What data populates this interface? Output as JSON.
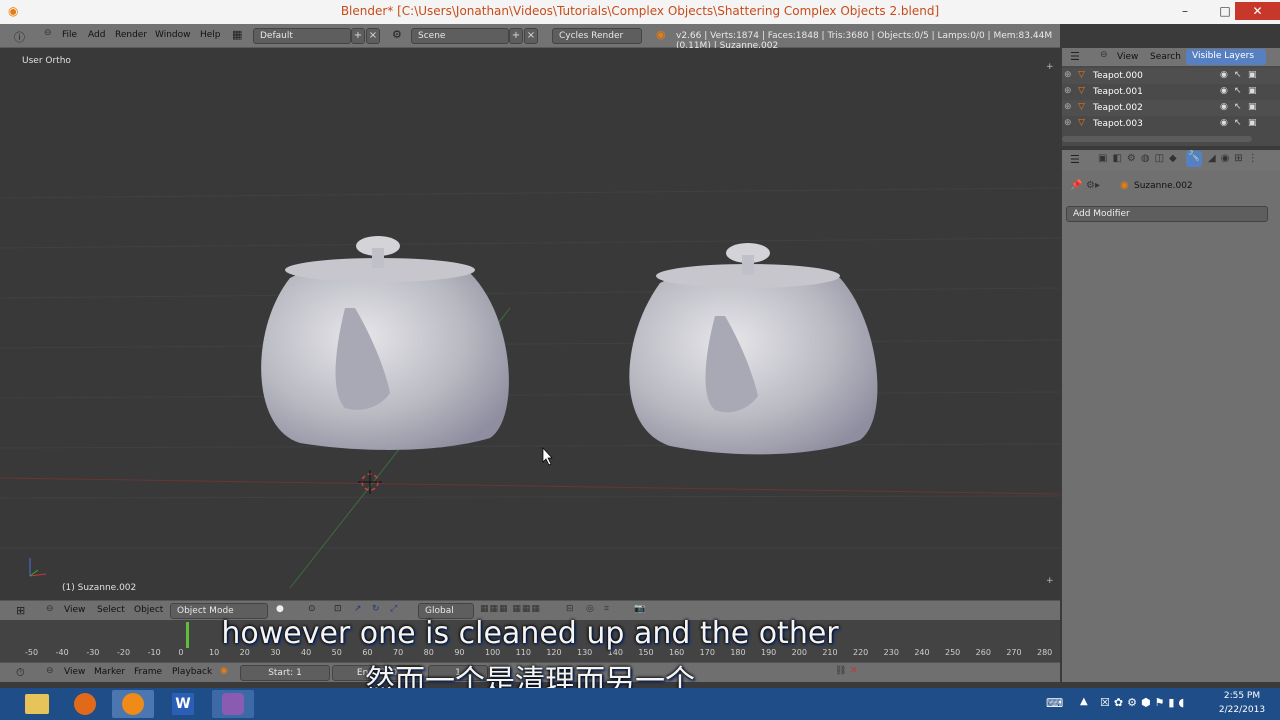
{
  "window": {
    "title": "Blender* [C:\\Users\\Jonathan\\Videos\\Tutorials\\Complex Objects\\Shattering Complex Objects 2.blend]",
    "minimize": "–",
    "maximize": "□",
    "close": "✕"
  },
  "menubar": {
    "file": "File",
    "add": "Add",
    "render": "Render",
    "window": "Window",
    "help": "Help",
    "layout": "Default",
    "scene": "Scene",
    "engine": "Cycles Render",
    "stats": "v2.66 | Verts:1874 | Faces:1848 | Tris:3680 | Objects:0/5 | Lamps:0/0 | Mem:83.44M (0.11M) | Suzanne.002"
  },
  "viewport": {
    "view_label": "User Ortho",
    "object_label": "(1) Suzanne.002"
  },
  "viewport_header": {
    "view": "View",
    "select": "Select",
    "object": "Object",
    "mode": "Object Mode",
    "orientation": "Global"
  },
  "timeline": {
    "ticks": [
      "-50",
      "-40",
      "-30",
      "-20",
      "-10",
      "0",
      "10",
      "20",
      "30",
      "40",
      "50",
      "60",
      "70",
      "80",
      "90",
      "100",
      "110",
      "120",
      "130",
      "140",
      "150",
      "160",
      "170",
      "180",
      "190",
      "200",
      "210",
      "220",
      "230",
      "240",
      "250",
      "260",
      "270",
      "280"
    ],
    "current_frame": "1"
  },
  "timeline_header": {
    "view": "View",
    "marker": "Marker",
    "frame": "Frame",
    "playback": "Playback",
    "start": "Start: 1",
    "end": "End: 250"
  },
  "outliner": {
    "view": "View",
    "search": "Search",
    "filter": "Visible Layers",
    "items": [
      {
        "label": "Teapot.000"
      },
      {
        "label": "Teapot.001"
      },
      {
        "label": "Teapot.002"
      },
      {
        "label": "Teapot.003"
      }
    ]
  },
  "properties": {
    "object_name": "Suzanne.002",
    "add_modifier": "Add Modifier"
  },
  "subtitles": {
    "english": "however one is cleaned up and the other",
    "chinese": "然而一个是清理而另一个"
  },
  "clock": {
    "time": "2:55 PM",
    "date": "2/22/2013"
  },
  "colors": {
    "accent": "#e87d0d",
    "taskbar": "#1e4d87",
    "active_tab": "#5680c2"
  }
}
